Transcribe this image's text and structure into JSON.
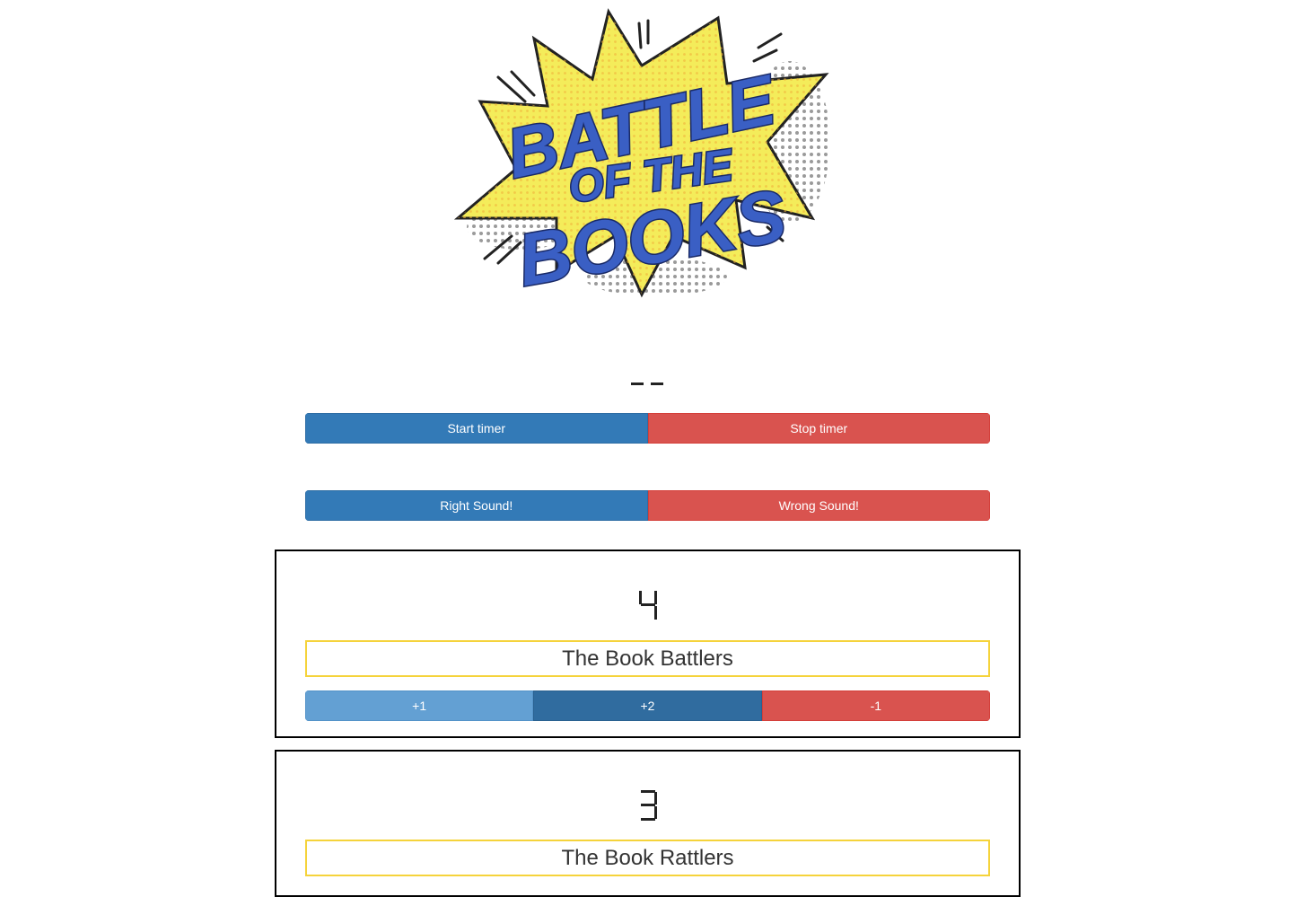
{
  "logo": {
    "line1": "BATTLE",
    "line2": "OF THE",
    "line3": "BOOKS"
  },
  "timer": {
    "display": "--",
    "start_label": "Start timer",
    "stop_label": "Stop timer"
  },
  "sounds": {
    "right_label": "Right Sound!",
    "wrong_label": "Wrong Sound!"
  },
  "teams": [
    {
      "score": "4",
      "name": "The Book Battlers",
      "plus1_label": "+1",
      "plus2_label": "+2",
      "minus1_label": "-1"
    },
    {
      "score": "3",
      "name": "The Book Rattlers"
    }
  ],
  "colors": {
    "primary": "#337ab7",
    "danger": "#d9534f",
    "light_blue": "#63a0d3",
    "dark_blue": "#306c9f",
    "team_name_border": "#f5d33b",
    "logo_burst": "#f4ec5a",
    "logo_text": "#3a5fc4"
  }
}
